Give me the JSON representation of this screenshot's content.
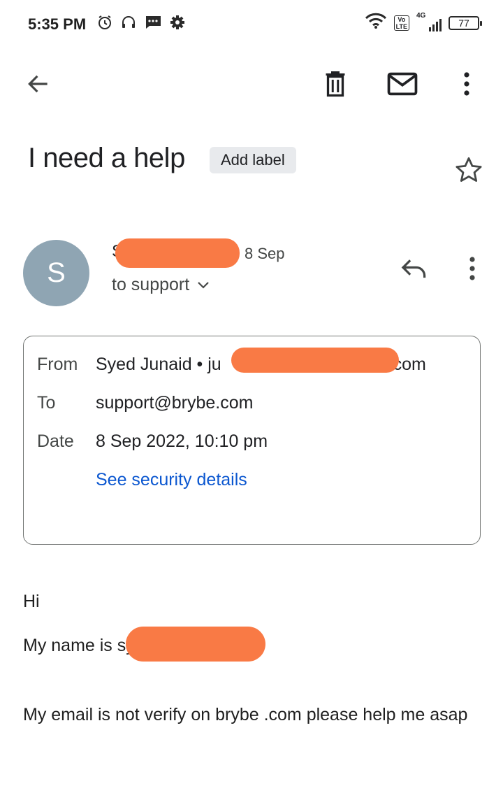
{
  "status_bar": {
    "time": "5:35 PM",
    "network": "4G",
    "battery": "77"
  },
  "email": {
    "subject": "I need a help",
    "add_label": "Add label",
    "sender_initial": "S",
    "sender_name_prefix": "S",
    "date_short": "8 Sep",
    "to_line": "to support",
    "details": {
      "from_label": "From",
      "from_name": "Syed Junaid • ju",
      "from_email_suffix": "nail.com",
      "to_label": "To",
      "to_value": "support@brybe.com",
      "date_label": "Date",
      "date_value": "8 Sep 2022, 10:10 pm",
      "security_link": "See security details"
    },
    "body": {
      "greeting": "Hi",
      "name_line": "My name is sy",
      "message": "My email is not verify on brybe .com please help me asap"
    }
  },
  "colors": {
    "redaction": "#f97a45",
    "avatar": "#8fa5b3",
    "link": "#0b57d0"
  }
}
